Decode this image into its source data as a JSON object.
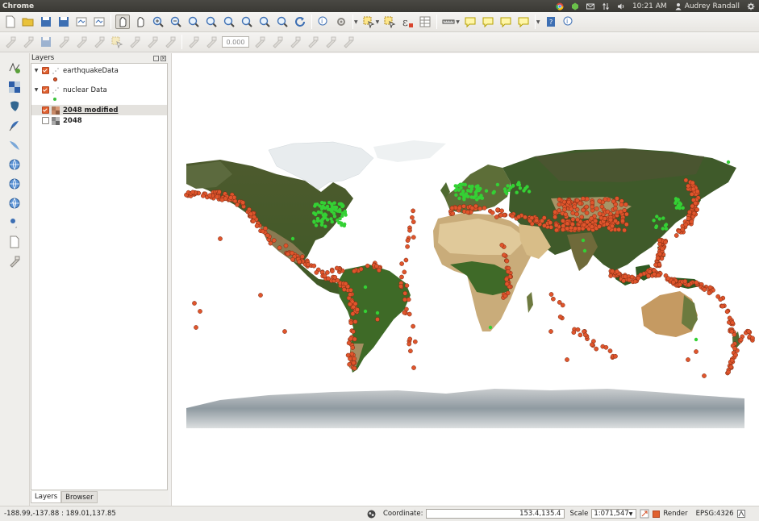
{
  "system_bar": {
    "app_title": "Chrome",
    "clock": "10:21 AM",
    "user": "Audrey Randall",
    "icons": [
      "chrome-icon",
      "network-icon",
      "mail-icon",
      "transfer-icon",
      "volume-icon",
      "user-icon",
      "settings-gear-icon"
    ]
  },
  "toolbar_top": {
    "icons": [
      "new-project-icon",
      "open-project-icon",
      "save-project-icon",
      "save-as-icon",
      "print-composer-icon",
      "composer-manager-icon",
      "pan-icon",
      "pan-to-selection-icon",
      "zoom-in-icon",
      "zoom-out-icon",
      "zoom-actual-icon",
      "zoom-full-icon",
      "zoom-to-selection-icon",
      "zoom-to-layer-icon",
      "zoom-last-icon",
      "zoom-next-icon",
      "refresh-icon",
      "identify-icon",
      "action-icon",
      "select-features-icon",
      "deselect-icon",
      "field-calculator-icon",
      "attribute-table-icon",
      "measure-icon",
      "map-tips-icon",
      "bookmark-icon",
      "show-bookmarks-icon",
      "text-annotation-icon",
      "help-icon",
      "whats-this-icon"
    ]
  },
  "toolbar_edit": {
    "icons": [
      "current-edits-icon",
      "toggle-editing-icon",
      "save-edits-icon",
      "add-feature-icon",
      "move-feature-icon",
      "node-tool-icon",
      "delete-selected-icon",
      "cut-features-icon",
      "copy-features-icon",
      "paste-features-icon",
      "rotate-label-icon",
      "label-icon",
      "pin-labels-icon",
      "show-hide-labels-icon",
      "move-label-icon",
      "rotate-labels-icon",
      "change-label-icon",
      "diagram-icon"
    ],
    "rotation_value": "0.000"
  },
  "left_toolbar": {
    "icons": [
      "add-vector-layer-icon",
      "add-raster-layer-icon",
      "add-postgis-layer-icon",
      "add-spatialite-layer-icon",
      "add-mssql-layer-icon",
      "add-wms-layer-icon",
      "add-wcs-layer-icon",
      "add-wfs-layer-icon",
      "add-delimited-text-icon",
      "new-shapefile-icon",
      "remove-layer-icon"
    ]
  },
  "layers_panel": {
    "title": "Layers",
    "tabs": [
      "Layers",
      "Browser"
    ],
    "layers": [
      {
        "name": "earthquakeData",
        "checked": true,
        "symbol_color": "#e35b2e"
      },
      {
        "name": "nuclear Data",
        "checked": true,
        "symbol_color": "#3cc23c"
      },
      {
        "name": "2048 modified",
        "checked": true,
        "selected": true
      },
      {
        "name": "2048",
        "checked": false
      }
    ]
  },
  "map": {
    "earthquake_color": "#e0552c",
    "nuclear_color": "#34d134"
  },
  "status_bar": {
    "extents": "-188.99,-137.88 : 189.01,137.85",
    "coordinate_label": "Coordinate:",
    "coordinate_value": "153.4,135.4",
    "scale_label": "Scale",
    "scale_value": "1:071,547",
    "render_label": "Render",
    "crs": "EPSG:4326"
  }
}
